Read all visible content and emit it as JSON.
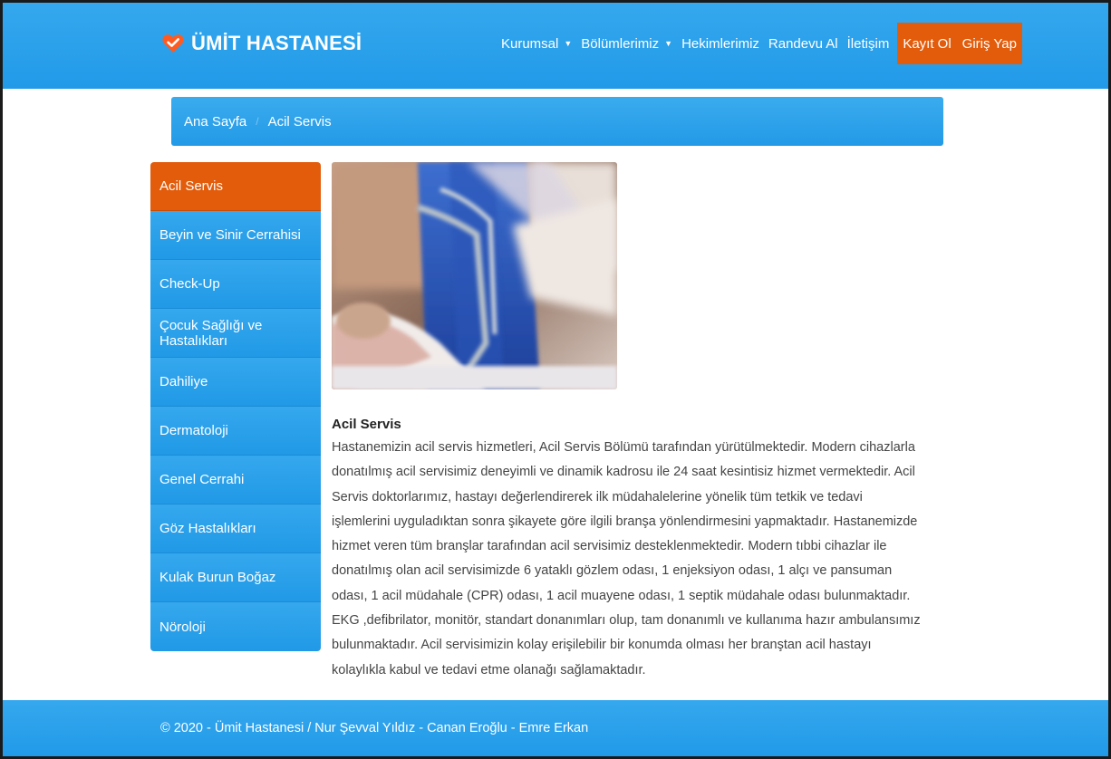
{
  "brand": {
    "name": "ÜMİT HASTANESİ",
    "icon": "heart-check-icon",
    "icon_color": "#ff5a1f"
  },
  "nav": {
    "items": [
      {
        "label": "Kurumsal",
        "dropdown": true
      },
      {
        "label": "Bölümlerimiz",
        "dropdown": true
      },
      {
        "label": "Hekimlerimiz",
        "dropdown": false
      },
      {
        "label": "Randevu Al",
        "dropdown": false
      },
      {
        "label": "İletişim",
        "dropdown": false
      }
    ],
    "register_label": "Kayıt Ol",
    "login_label": "Giriş Yap"
  },
  "breadcrumb": {
    "home": "Ana Sayfa",
    "current": "Acil Servis"
  },
  "sidebar": {
    "items": [
      {
        "label": "Acil Servis",
        "active": true
      },
      {
        "label": "Beyin ve Sinir Cerrahisi",
        "active": false
      },
      {
        "label": "Check-Up",
        "active": false
      },
      {
        "label": "Çocuk Sağlığı ve Hastalıkları",
        "active": false
      },
      {
        "label": "Dahiliye",
        "active": false
      },
      {
        "label": "Dermatoloji",
        "active": false
      },
      {
        "label": "Genel Cerrahi",
        "active": false
      },
      {
        "label": "Göz Hastalıkları",
        "active": false
      },
      {
        "label": "Kulak Burun Boğaz",
        "active": false
      },
      {
        "label": "Nöroloji",
        "active": false
      }
    ]
  },
  "content": {
    "title": "Acil Servis",
    "body": "Hastanemizin acil servis hizmetleri, Acil Servis Bölümü tarafından yürütülmektedir. Modern cihazlarla donatılmış acil servisimiz deneyimli ve dinamik kadrosu ile 24 saat kesintisiz hizmet vermektedir. Acil Servis doktorlarımız, hastayı değerlendirerek ilk müdahalelerine yönelik tüm tetkik ve tedavi işlemlerini uyguladıktan sonra şikayete göre ilgili branşa yönlendirmesini yapmaktadır. Hastanemizde hizmet veren tüm branşlar tarafından acil servisimiz desteklenmektedir. Modern tıbbi cihazlar ile donatılmış olan acil servisimizde 6 yataklı gözlem odası, 1 enjeksiyon odası, 1 alçı ve pansuman odası, 1 acil müdahale (CPR) odası, 1 acil muayene odası, 1 septik müdahale odası bulunmaktadır. EKG ,defibrilator, monitör, standart donanımları olup, tam donanımlı ve kullanıma hazır ambulansımız bulunmaktadır. Acil servisimizin kolay erişilebilir bir konumda olması her branştan acil hastayı kolaylıkla kabul ve tedavi etme olanağı sağlamaktadır."
  },
  "footer": {
    "text": "© 2020 - Ümit Hastanesi / Nur Şevval Yıldız - Canan Eroğlu - Emre Erkan"
  },
  "colors": {
    "primary": "#2a9fea",
    "accent": "#e25c0b"
  }
}
